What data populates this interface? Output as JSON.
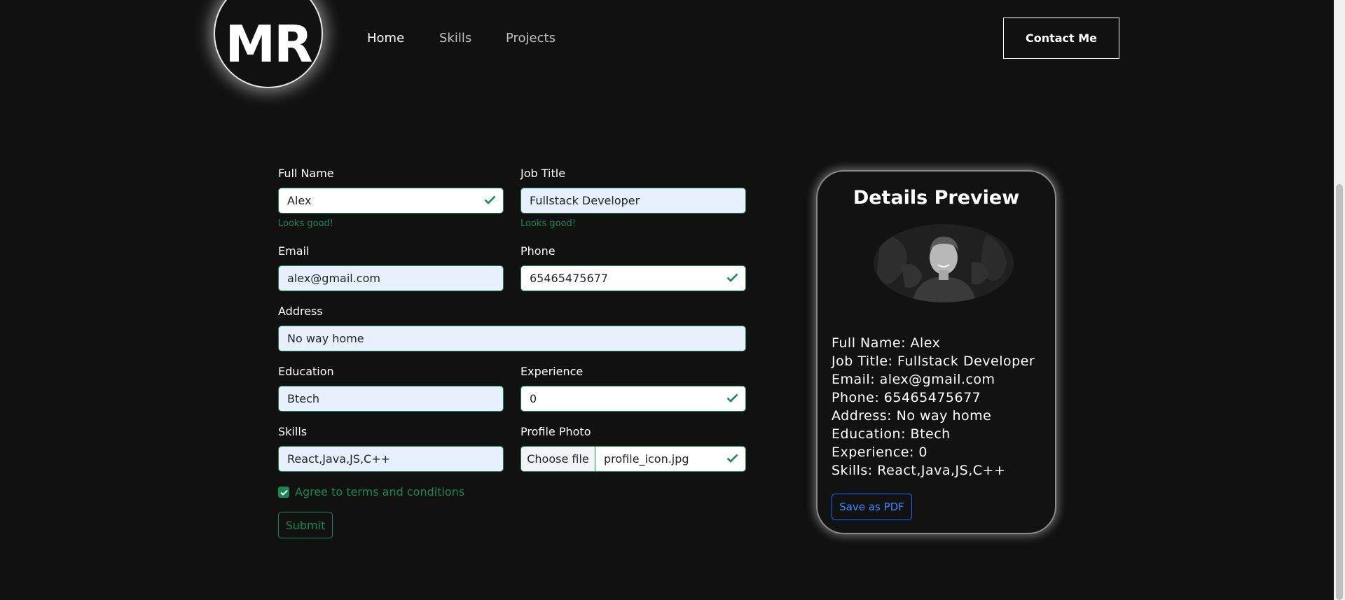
{
  "nav": {
    "logo_text": "MR",
    "links": [
      "Home",
      "Skills",
      "Projects"
    ],
    "contact_label": "Contact Me"
  },
  "form": {
    "full_name": {
      "label": "Full Name",
      "value": "Alex",
      "hint": "Looks good!"
    },
    "job_title": {
      "label": "Job Title",
      "value": "Fullstack Developer",
      "hint": "Looks good!"
    },
    "email": {
      "label": "Email",
      "value": "alex@gmail.com"
    },
    "phone": {
      "label": "Phone",
      "value": "65465475677"
    },
    "address": {
      "label": "Address",
      "value": "No way home"
    },
    "education": {
      "label": "Education",
      "value": "Btech"
    },
    "experience": {
      "label": "Experience",
      "value": "0"
    },
    "skills": {
      "label": "Skills",
      "value": "React,Java,JS,C++"
    },
    "profile_photo": {
      "label": "Profile Photo",
      "button": "Choose file",
      "filename": "profile_icon.jpg"
    },
    "agree_label": "Agree to terms and conditions",
    "submit_label": "Submit"
  },
  "preview": {
    "title": "Details Preview",
    "lines": [
      "Full Name: Alex",
      "Job Title: Fullstack Developer",
      "Email: alex@gmail.com",
      "Phone: 65465475677",
      "Address: No way home",
      "Education: Btech",
      "Experience: 0",
      "Skills: React,Java,JS,C++"
    ],
    "pdf_label": "Save as PDF"
  },
  "colors": {
    "background": "#111111",
    "valid_green": "#198754",
    "input_fill": "#e8f0fe",
    "link_blue": "#0d6efd"
  }
}
